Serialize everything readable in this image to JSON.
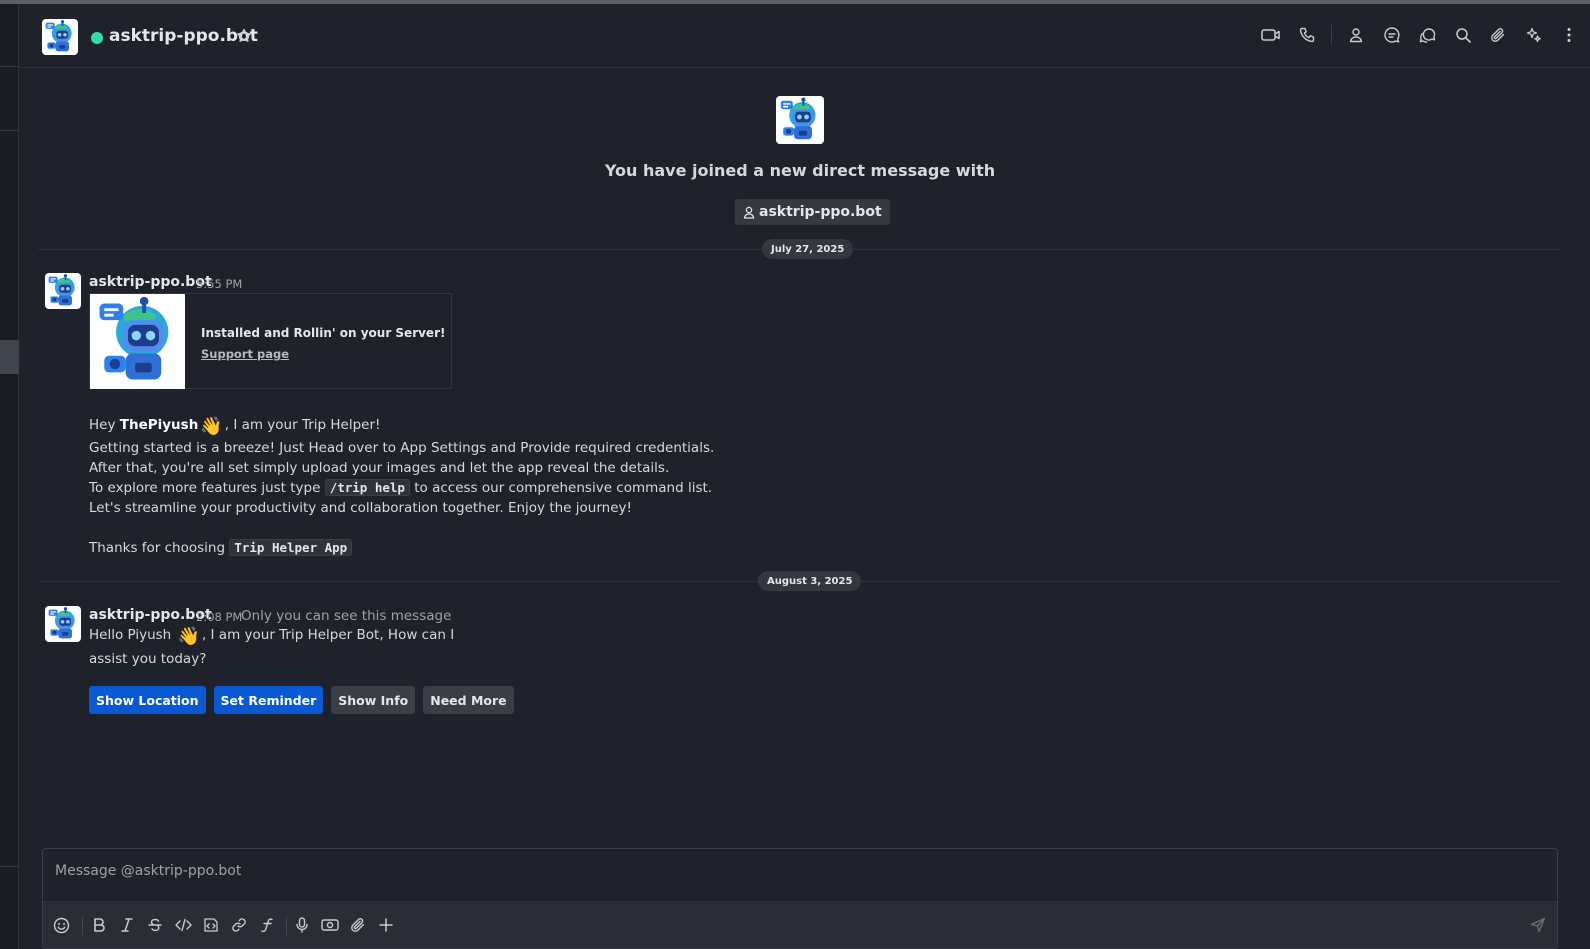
{
  "header": {
    "title": "asktrip-ppo.bot",
    "status": "online",
    "icons": [
      "video-call-icon",
      "phone-icon",
      "user-info-icon",
      "threads-icon",
      "discussions-icon",
      "search-icon",
      "attachments-icon",
      "apps-icon",
      "kebab-menu-icon"
    ]
  },
  "intro": {
    "text": "You have joined a new direct message with",
    "chip_label": "asktrip-ppo.bot"
  },
  "dates": {
    "first": "July 27, 2025",
    "second": "August 3, 2025"
  },
  "message1": {
    "author": "asktrip-ppo.bot",
    "time": "5:55 PM",
    "attachment_title": "Installed and Rollin' on your Server!",
    "attachment_link": "Support page",
    "greet_prefix": "Hey ",
    "greet_name": "ThePiyush",
    "greet_suffix": ", I am your Trip Helper!",
    "wave": "👋",
    "line2": "Getting started is a breeze! Just Head over to App Settings and Provide required credentials.",
    "line3": "After that, you're all set simply upload your images and let the app reveal the details.",
    "line4_prefix": "To explore more features just type ",
    "line4_code": "/trip help",
    "line4_suffix": " to access our comprehensive command list.",
    "line5": "Let's streamline your productivity and collaboration together. Enjoy the journey!",
    "thanks_prefix": "Thanks for choosing ",
    "thanks_code": "Trip Helper App"
  },
  "message2": {
    "author": "asktrip-ppo.bot",
    "time": "2:08 PM",
    "note": "Only you can see this message",
    "line1_prefix": "Hello Piyush ",
    "wave": "👋",
    "line1_suffix": ", I am your Trip Helper Bot, How can I",
    "line2": "assist you today?",
    "buttons": [
      {
        "label": "Show Location",
        "style": "primary"
      },
      {
        "label": "Set Reminder",
        "style": "primary"
      },
      {
        "label": "Show Info",
        "style": "secondary"
      },
      {
        "label": "Need More",
        "style": "secondary"
      }
    ]
  },
  "composer": {
    "placeholder": "Message @asktrip-ppo.bot",
    "value": "",
    "tools": [
      "emoji-icon",
      "bold-icon",
      "italic-icon",
      "strikethrough-icon",
      "code-icon",
      "code-block-icon",
      "link-icon",
      "formula-icon",
      "microphone-icon",
      "video-message-icon",
      "attach-icon",
      "plus-icon",
      "send-icon"
    ]
  },
  "colors": {
    "background": "#1f222a",
    "primary_button": "#095ad2",
    "status_online": "#2de0a5"
  }
}
